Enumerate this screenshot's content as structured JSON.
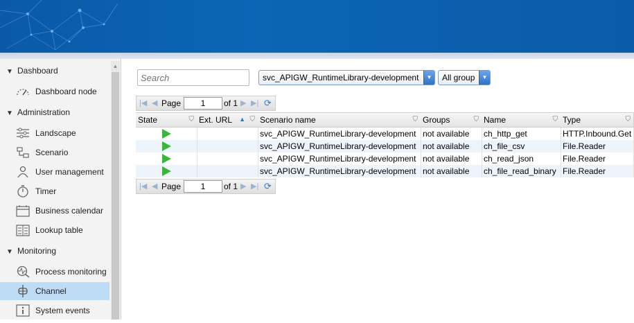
{
  "sidebar": {
    "sections": [
      {
        "label": "Dashboard",
        "items": [
          {
            "label": "Dashboard node",
            "icon": "dashboard-gauge-icon"
          }
        ]
      },
      {
        "label": "Administration",
        "items": [
          {
            "label": "Landscape",
            "icon": "landscape-sliders-icon"
          },
          {
            "label": "Scenario",
            "icon": "scenario-flow-icon"
          },
          {
            "label": "User management",
            "icon": "user-icon"
          },
          {
            "label": "Timer",
            "icon": "timer-icon"
          },
          {
            "label": "Business calendar",
            "icon": "calendar-icon"
          },
          {
            "label": "Lookup table",
            "icon": "lookup-table-icon"
          }
        ]
      },
      {
        "label": "Monitoring",
        "items": [
          {
            "label": "Process monitoring",
            "icon": "process-monitoring-icon"
          },
          {
            "label": "Channel",
            "icon": "channel-icon"
          },
          {
            "label": "System events",
            "icon": "info-icon"
          }
        ]
      }
    ],
    "selected": "Channel"
  },
  "toolbar": {
    "search_placeholder": "Search",
    "scenario_select": "svc_APIGW_RuntimeLibrary-development",
    "group_select": "All group"
  },
  "pager": {
    "page_label": "Page",
    "page_value": "1",
    "of_label": "of 1"
  },
  "table": {
    "columns": [
      "State",
      "Ext. URL",
      "Scenario name",
      "Groups",
      "Name",
      "Type"
    ],
    "rows": [
      {
        "state": "running",
        "ext_url": "",
        "scenario": "svc_APIGW_RuntimeLibrary-development",
        "groups": "not available",
        "name": "ch_http_get",
        "type": "HTTP.Inbound.Get"
      },
      {
        "state": "running",
        "ext_url": "",
        "scenario": "svc_APIGW_RuntimeLibrary-development",
        "groups": "not available",
        "name": "ch_file_csv",
        "type": "File.Reader"
      },
      {
        "state": "running",
        "ext_url": "",
        "scenario": "svc_APIGW_RuntimeLibrary-development",
        "groups": "not available",
        "name": "ch_read_json",
        "type": "File.Reader"
      },
      {
        "state": "running",
        "ext_url": "",
        "scenario": "svc_APIGW_RuntimeLibrary-development",
        "groups": "not available",
        "name": "ch_file_read_binary",
        "type": "File.Reader"
      }
    ]
  },
  "colors": {
    "banner": "#0b5fae",
    "selected_item": "#bfdcf7",
    "running_state": "#3bb53b"
  }
}
